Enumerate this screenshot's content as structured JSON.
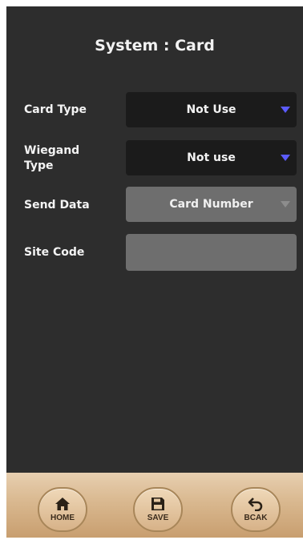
{
  "header": {
    "title": "System : Card"
  },
  "form": {
    "card_type": {
      "label": "Card Type",
      "value": "Not Use"
    },
    "wiegand_type": {
      "label": "Wiegand Type",
      "value": "Not use"
    },
    "send_data": {
      "label": "Send Data",
      "value": "Card Number"
    },
    "site_code": {
      "label": "Site Code",
      "value": ""
    }
  },
  "footer": {
    "home_label": "HOME",
    "save_label": "SAVE",
    "back_label": "BCAK"
  },
  "colors": {
    "background": "#2d2d2d",
    "dropdown_dark": "#1b1b1b",
    "dropdown_disabled": "#6e6e6e",
    "arrow_accent": "#5b5bff",
    "footer_gold": "#d9b88f"
  },
  "icons": {
    "home": "house-icon",
    "save": "floppy-disk-icon",
    "back": "undo-arrow-icon",
    "dropdown": "triangle-down-icon"
  }
}
